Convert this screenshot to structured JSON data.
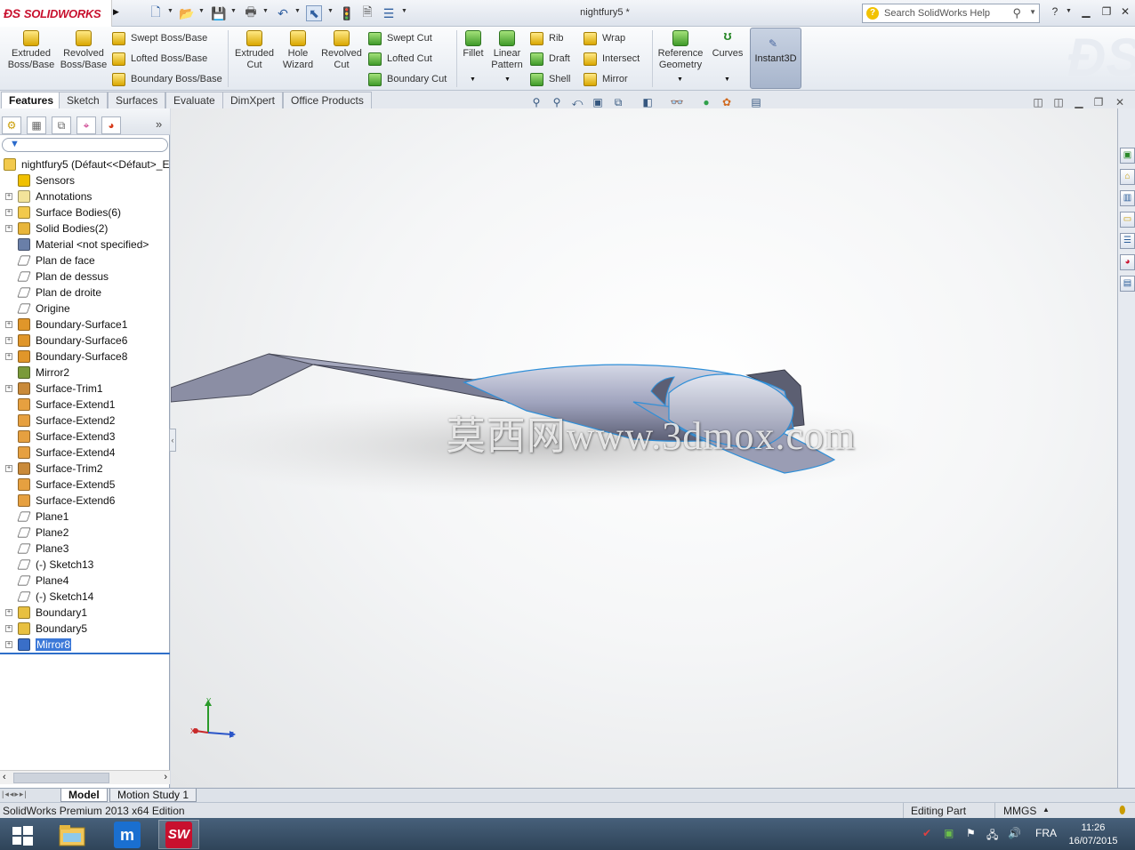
{
  "titlebar": {
    "logo_text": "SOLIDWORKS",
    "document_title": "nightfury5 *",
    "search_placeholder": "Search SolidWorks Help"
  },
  "ribbon": {
    "extruded_boss": "Extruded\nBoss/Base",
    "revolved_boss": "Revolved\nBoss/Base",
    "swept_boss": "Swept Boss/Base",
    "lofted_boss": "Lofted Boss/Base",
    "boundary_boss": "Boundary Boss/Base",
    "extruded_cut": "Extruded\nCut",
    "hole_wizard": "Hole\nWizard",
    "revolved_cut": "Revolved\nCut",
    "swept_cut": "Swept Cut",
    "lofted_cut": "Lofted Cut",
    "boundary_cut": "Boundary Cut",
    "fillet": "Fillet",
    "linear_pattern": "Linear\nPattern",
    "rib": "Rib",
    "draft": "Draft",
    "shell": "Shell",
    "wrap": "Wrap",
    "intersect": "Intersect",
    "mirror": "Mirror",
    "reference_geometry": "Reference\nGeometry",
    "curves": "Curves",
    "instant3d": "Instant3D"
  },
  "tabs": [
    "Features",
    "Sketch",
    "Surfaces",
    "Evaluate",
    "DimXpert",
    "Office Products"
  ],
  "tree": {
    "root": "nightfury5  (Défaut<<Défaut>_E",
    "items": [
      {
        "label": "Sensors",
        "expand": false,
        "icon": "sensor-icon"
      },
      {
        "label": "Annotations",
        "expand": true,
        "icon": "annotation-icon"
      },
      {
        "label": "Surface Bodies(6)",
        "expand": true,
        "icon": "surface-bodies-icon"
      },
      {
        "label": "Solid Bodies(2)",
        "expand": true,
        "icon": "solid-bodies-icon"
      },
      {
        "label": "Material <not specified>",
        "expand": false,
        "icon": "material-icon"
      },
      {
        "label": "Plan de face",
        "expand": false,
        "icon": "plane-icon"
      },
      {
        "label": "Plan de dessus",
        "expand": false,
        "icon": "plane-icon"
      },
      {
        "label": "Plan de droite",
        "expand": false,
        "icon": "plane-icon"
      },
      {
        "label": "Origine",
        "expand": false,
        "icon": "origin-icon"
      },
      {
        "label": "Boundary-Surface1",
        "expand": true,
        "icon": "boundary-surface-icon"
      },
      {
        "label": "Boundary-Surface6",
        "expand": true,
        "icon": "boundary-surface-icon"
      },
      {
        "label": "Boundary-Surface8",
        "expand": true,
        "icon": "boundary-surface-icon"
      },
      {
        "label": "Mirror2",
        "expand": false,
        "icon": "mirror-icon"
      },
      {
        "label": "Surface-Trim1",
        "expand": true,
        "icon": "surface-trim-icon"
      },
      {
        "label": "Surface-Extend1",
        "expand": false,
        "icon": "surface-extend-icon"
      },
      {
        "label": "Surface-Extend2",
        "expand": false,
        "icon": "surface-extend-icon"
      },
      {
        "label": "Surface-Extend3",
        "expand": false,
        "icon": "surface-extend-icon"
      },
      {
        "label": "Surface-Extend4",
        "expand": false,
        "icon": "surface-extend-icon"
      },
      {
        "label": "Surface-Trim2",
        "expand": true,
        "icon": "surface-trim-icon"
      },
      {
        "label": "Surface-Extend5",
        "expand": false,
        "icon": "surface-extend-icon"
      },
      {
        "label": "Surface-Extend6",
        "expand": false,
        "icon": "surface-extend-icon"
      },
      {
        "label": "Plane1",
        "expand": false,
        "icon": "plane-icon"
      },
      {
        "label": "Plane2",
        "expand": false,
        "icon": "plane-icon"
      },
      {
        "label": "Plane3",
        "expand": false,
        "icon": "plane-icon"
      },
      {
        "label": "(-) Sketch13",
        "expand": false,
        "icon": "sketch-icon"
      },
      {
        "label": "Plane4",
        "expand": false,
        "icon": "plane-icon"
      },
      {
        "label": "(-) Sketch14",
        "expand": false,
        "icon": "sketch-icon"
      },
      {
        "label": "Boundary1",
        "expand": true,
        "icon": "boundary-boss-icon"
      },
      {
        "label": "Boundary5",
        "expand": true,
        "icon": "boundary-boss-icon"
      },
      {
        "label": "Mirror8",
        "expand": true,
        "icon": "mirror-body-icon",
        "selected": true
      }
    ]
  },
  "viewport": {
    "watermark": "莫西网www.3dmox.com",
    "triad_x": "X",
    "triad_y": "Y",
    "triad_z": "Z"
  },
  "bottom_tabs": [
    "Model",
    "Motion Study 1"
  ],
  "status": {
    "left": "SolidWorks Premium 2013 x64 Edition",
    "editing": "Editing Part",
    "units": "MMGS"
  },
  "taskbar": {
    "language": "FRA",
    "time": "11:26",
    "date": "16/07/2015"
  },
  "colors": {
    "brand_red": "#c8102e",
    "selection_blue": "#3b78d8",
    "model_edge_blue": "#2f8fd8"
  }
}
